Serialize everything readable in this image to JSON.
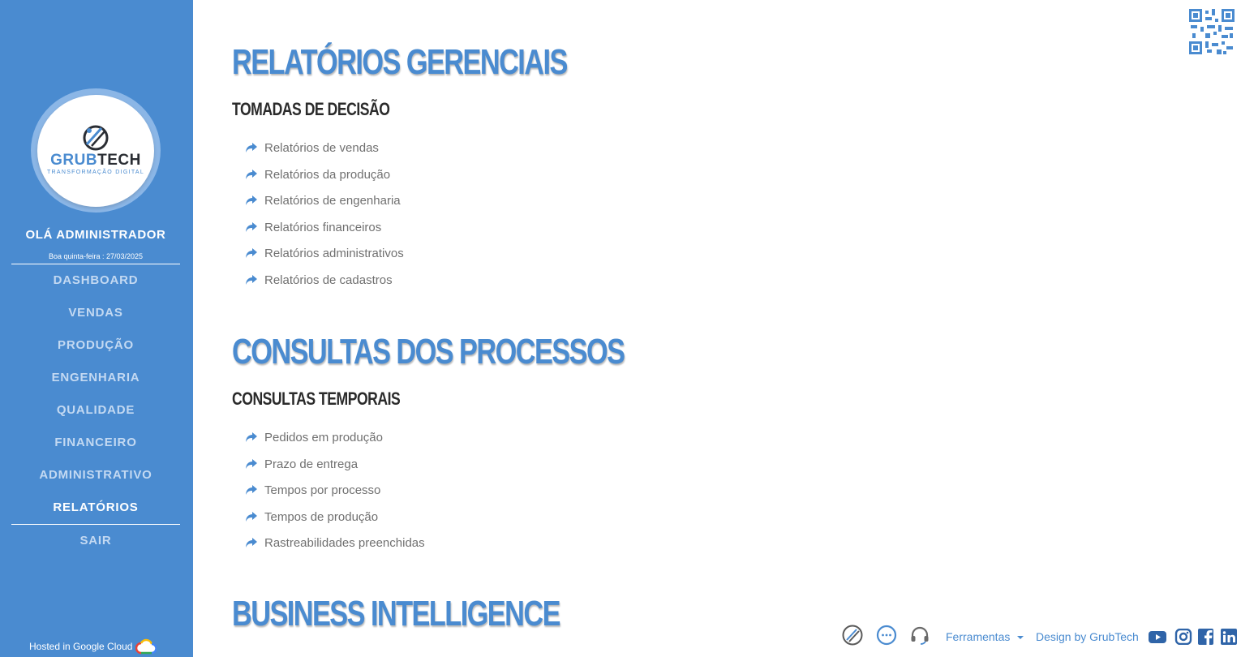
{
  "sidebar": {
    "logo": {
      "word_left": "GRUB",
      "word_right": "TECH",
      "tagline": "TRANSFORMAÇÃO DIGITAL"
    },
    "greeting": "OLÁ ADMINISTRADOR",
    "date": "Boa quinta-feira : 27/03/2025",
    "nav": [
      {
        "label": "DASHBOARD"
      },
      {
        "label": "VENDAS"
      },
      {
        "label": "PRODUÇÃO"
      },
      {
        "label": "ENGENHARIA"
      },
      {
        "label": "QUALIDADE"
      },
      {
        "label": "FINANCEIRO"
      },
      {
        "label": "ADMINISTRATIVO"
      },
      {
        "label": "RELATÓRIOS"
      },
      {
        "label": "SAIR"
      }
    ],
    "hosted": "Hosted in Google Cloud"
  },
  "main": {
    "sections": [
      {
        "title": "RELATÓRIOS GERENCIAIS",
        "subtitle": "TOMADAS DE DECISÃO",
        "links": [
          "Relatórios de vendas",
          "Relatórios da produção",
          "Relatórios de engenharia",
          "Relatórios financeiros",
          "Relatórios administrativos",
          "Relatórios de cadastros"
        ]
      },
      {
        "title": "CONSULTAS DOS PROCESSOS",
        "subtitle": "CONSULTAS TEMPORAIS",
        "links": [
          "Pedidos em produção",
          "Prazo de entrega",
          "Tempos por processo",
          "Tempos de produção",
          "Rastreabilidades preenchidas"
        ]
      },
      {
        "title": "BUSINESS INTELLIGENCE"
      }
    ]
  },
  "footer": {
    "tools": "Ferramentas",
    "design": "Design by GrubTech"
  },
  "colors": {
    "accent": "#4a8bd0",
    "sidebar_bg": "#4a8bd0",
    "nav_inactive": "#c3d9f2",
    "link_text": "#707070"
  }
}
